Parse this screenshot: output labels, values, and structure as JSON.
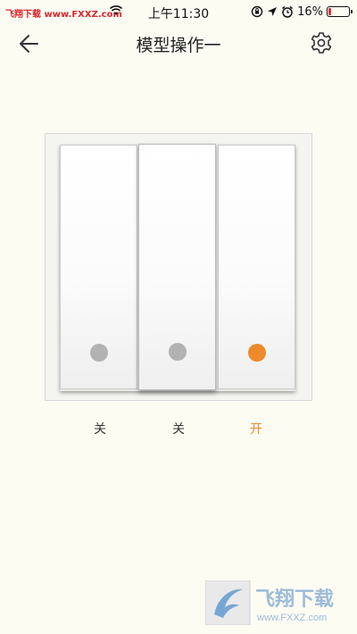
{
  "status_bar": {
    "carrier": "飞翔下载 www.FXXZ.com",
    "time": "上午11:30",
    "battery": "16%",
    "battery_level": 0.16
  },
  "nav": {
    "title": "模型操作一"
  },
  "switches": [
    {
      "state": "关",
      "on": false
    },
    {
      "state": "关",
      "on": false
    },
    {
      "state": "开",
      "on": true
    }
  ],
  "colors": {
    "background": "#fdfcf3",
    "on_accent": "#ee8a2c",
    "off_indicator": "#b2b2b2"
  },
  "watermark": {
    "brand": "飞翔下载",
    "url": "www.FXXZ.com"
  }
}
